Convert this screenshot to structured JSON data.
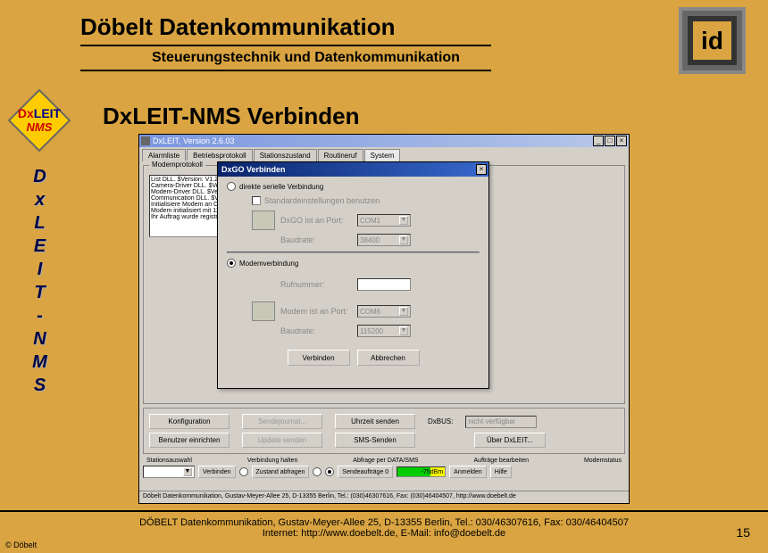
{
  "header": {
    "title": "Döbelt Datenkommunikation",
    "subtitle": "Steuerungstechnik und Datenkommunikation"
  },
  "logo_text": "id",
  "sidebar": {
    "logo_dx": "Dx",
    "logo_leit": "LEIT",
    "logo_sub": "NMS",
    "letters": "D\nx\nL\nE\nI\nT\n-\nN\nM\nS"
  },
  "content_title": "DxLEIT-NMS Verbinden",
  "window": {
    "title": "DxLEIT, Version 2.6.03",
    "tabs": [
      "Alarmliste",
      "Betriebsprotokoll",
      "Stationszustand",
      "Routineruf",
      "System"
    ],
    "active_tab": 4,
    "group_label": "Modemprotokoll",
    "list_items": [
      "List DLL. $Version: V1.2",
      "Camera-Driver DLL. $Ve",
      "Modem-Driver DLL. $Ve",
      "Communication DLL. $V",
      "Initialisiere Modem an CO",
      "Modem initialisiert mit 115",
      "Ihr Auftrag wurde registrie"
    ],
    "dialog": {
      "title": "DxGO Verbinden",
      "radio_direct": "direkte serielle Verbindung",
      "check_default": "Standardeinstellungen benutzen",
      "port_label": "DxGO ist an Port:",
      "port_value": "COM1",
      "baud_label": "Baudrate:",
      "baud_value": "38400",
      "radio_modem": "Modemverbindung",
      "phone_label": "Rufnummer:",
      "modem_port_label": "Modem ist an Port:",
      "modem_port_value": "COM6",
      "modem_baud_label": "Baudrate:",
      "modem_baud_value": "115200",
      "btn_connect": "Verbinden",
      "btn_cancel": "Abbrechen"
    },
    "buttons": {
      "config": "Konfiguration",
      "sendjournal": "Sendejournal...",
      "sendtime": "Uhrzeit senden",
      "dxbus_label": "DxBUS:",
      "dxbus_value": "nicht verfügbar",
      "users": "Benutzer einrichten",
      "update": "Update senden",
      "sms": "SMS-Senden",
      "about": "Über DxLEIT..."
    },
    "status": {
      "station_label": "Stationsauswahl",
      "connhalt_label": "Verbindung  halten",
      "poll_label": "Abfrage per DATA/SMS",
      "edit_label": "Aufträge bearbeiten",
      "modem_label": "Modemstatus",
      "verbinden": "Verbinden",
      "zustand": "Zustand abfragen",
      "sendeauf": "Sendeaufträge 0",
      "dbm": "-75dBm",
      "anmelden": "Anmelden",
      "hilfe": "Hilfe"
    },
    "statusbar": "Döbelt Datenkommunikation, Gustav-Meyer-Allee 25, D-13355 Berlin, Tel.: (030)46307616, Fax: (030)46404507, http://www.doebelt.de"
  },
  "footer": {
    "line1": "DÖBELT Datenkommunikation, Gustav-Meyer-Allee 25, D-13355 Berlin, Tel.: 030/46307616, Fax: 030/46404507",
    "line2": "Internet: http://www.doebelt.de, E-Mail: info@doebelt.de",
    "copyright": "© Döbelt",
    "page": "15"
  }
}
